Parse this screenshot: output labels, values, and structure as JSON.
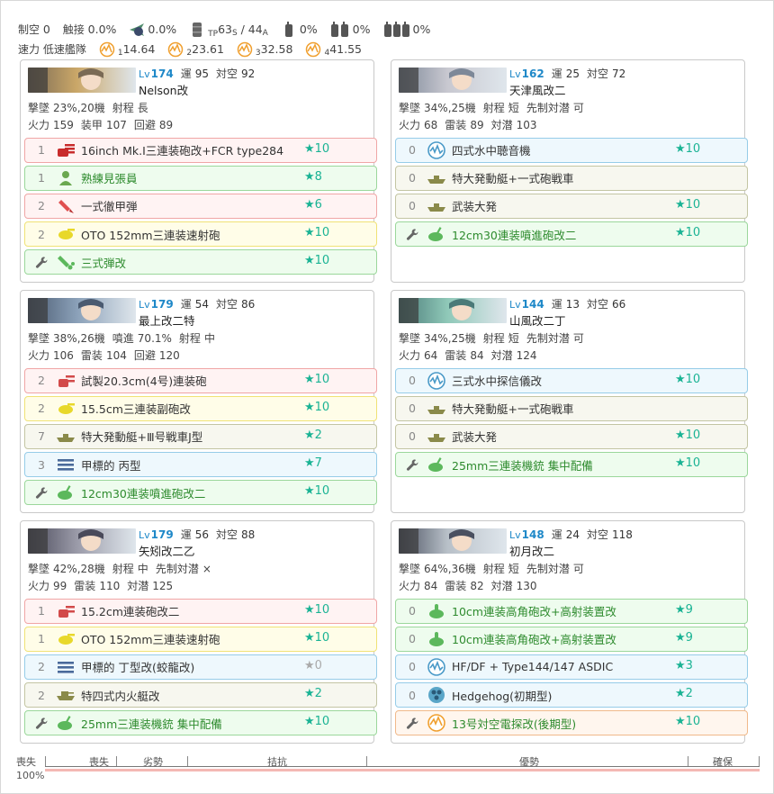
{
  "summary": {
    "air_control_label": "制空",
    "air_control_value": "0",
    "contact_label": "触接",
    "contact_value": "0.0%",
    "contact_plane_value": "0.0%",
    "tp_value": "63",
    "tp_sub": "S",
    "tp_slash": "/ 44",
    "tp_sub2": "A",
    "drum1_value": "0%",
    "drum2_value": "0%",
    "drum3_value": "0%",
    "speed_label": "速力",
    "speed_value": "低速艦隊",
    "los": [
      {
        "sub": "1",
        "value": "14.64"
      },
      {
        "sub": "2",
        "value": "23.61"
      },
      {
        "sub": "3",
        "value": "32.58"
      },
      {
        "sub": "4",
        "value": "41.55"
      }
    ]
  },
  "labels": {
    "lv": "Lv",
    "luck": "運",
    "aa": "対空",
    "shootdown": "撃墜",
    "range": "射程",
    "oasw": "先制対潜",
    "fp": "火力",
    "armor": "装甲",
    "evasion": "回避",
    "torpedo": "雷装",
    "asw": "対潜",
    "spread": "噴進"
  },
  "ships": [
    {
      "level": "174",
      "luck": "95",
      "aa": "92",
      "name": "Nelson改",
      "shootdown": "23%,20機",
      "range": "長",
      "stats": [
        {
          "l": "火力",
          "v": "159"
        },
        {
          "l": "装甲",
          "v": "107"
        },
        {
          "l": "回避",
          "v": "89"
        }
      ],
      "equip": [
        {
          "slot": "1",
          "name": "16inch Mk.I三連装砲改+FCR type284",
          "star": "★10",
          "color": "red",
          "icon": "heavy-gun-icon"
        },
        {
          "slot": "1",
          "name": "熟練見張員",
          "star": "★8",
          "color": "green",
          "icon": "lookout-icon"
        },
        {
          "slot": "2",
          "name": "一式徹甲弾",
          "star": "★6",
          "color": "red",
          "icon": "ap-shell-icon"
        },
        {
          "slot": "2",
          "name": "OTO 152mm三連装速射砲",
          "star": "★10",
          "color": "yellow",
          "icon": "secondary-gun-icon"
        },
        {
          "slot": "",
          "name": "三式弾改",
          "star": "★10",
          "color": "green",
          "icon": "type3-shell-icon",
          "fit": true
        }
      ]
    },
    {
      "level": "162",
      "luck": "25",
      "aa": "72",
      "name": "天津風改二",
      "shootdown": "34%,25機",
      "range": "短",
      "oasw": "可",
      "stats": [
        {
          "l": "火力",
          "v": "68"
        },
        {
          "l": "雷装",
          "v": "89"
        },
        {
          "l": "対潜",
          "v": "103"
        }
      ],
      "equip": [
        {
          "slot": "0",
          "name": "四式水中聴音機",
          "star": "★10",
          "color": "blue",
          "icon": "sonar-icon"
        },
        {
          "slot": "0",
          "name": "特大発動艇+一式砲戦車",
          "star": "",
          "color": "olive",
          "icon": "landing-craft-icon"
        },
        {
          "slot": "0",
          "name": "武装大発",
          "star": "★10",
          "color": "olive",
          "icon": "landing-craft-icon"
        },
        {
          "slot": "",
          "name": "12cm30連装噴進砲改二",
          "star": "★10",
          "color": "green",
          "icon": "aa-gun-icon",
          "fit": true
        }
      ]
    },
    {
      "level": "179",
      "luck": "54",
      "aa": "86",
      "name": "最上改二特",
      "shootdown": "38%,26機",
      "spread": "70.1%",
      "range": "中",
      "stats": [
        {
          "l": "火力",
          "v": "106"
        },
        {
          "l": "雷装",
          "v": "104"
        },
        {
          "l": "回避",
          "v": "120"
        }
      ],
      "equip": [
        {
          "slot": "2",
          "name": "試製20.3cm(4号)連装砲",
          "star": "★10",
          "color": "red",
          "icon": "medium-gun-icon"
        },
        {
          "slot": "2",
          "name": "15.5cm三連装副砲改",
          "star": "★10",
          "color": "yellow",
          "icon": "secondary-gun-icon"
        },
        {
          "slot": "7",
          "name": "特大発動艇+Ⅲ号戦車J型",
          "star": "★2",
          "color": "olive",
          "icon": "landing-craft-icon"
        },
        {
          "slot": "3",
          "name": "甲標的 丙型",
          "star": "★7",
          "color": "blue",
          "icon": "midget-sub-icon"
        },
        {
          "slot": "",
          "name": "12cm30連装噴進砲改二",
          "star": "★10",
          "color": "green",
          "icon": "aa-gun-icon",
          "fit": true
        }
      ]
    },
    {
      "level": "144",
      "luck": "13",
      "aa": "66",
      "name": "山風改二丁",
      "shootdown": "34%,25機",
      "range": "短",
      "oasw": "可",
      "stats": [
        {
          "l": "火力",
          "v": "64"
        },
        {
          "l": "雷装",
          "v": "84"
        },
        {
          "l": "対潜",
          "v": "124"
        }
      ],
      "equip": [
        {
          "slot": "0",
          "name": "三式水中探信儀改",
          "star": "★10",
          "color": "blue",
          "icon": "sonar-icon"
        },
        {
          "slot": "0",
          "name": "特大発動艇+一式砲戦車",
          "star": "",
          "color": "olive",
          "icon": "landing-craft-icon"
        },
        {
          "slot": "0",
          "name": "武装大発",
          "star": "★10",
          "color": "olive",
          "icon": "landing-craft-icon"
        },
        {
          "slot": "",
          "name": "25mm三連装機銃 集中配備",
          "star": "★10",
          "color": "green",
          "icon": "aa-gun-icon",
          "fit": true
        }
      ]
    },
    {
      "level": "179",
      "luck": "56",
      "aa": "88",
      "name": "矢矧改二乙",
      "shootdown": "42%,28機",
      "range": "中",
      "oasw": "×",
      "stats": [
        {
          "l": "火力",
          "v": "99"
        },
        {
          "l": "雷装",
          "v": "110"
        },
        {
          "l": "対潜",
          "v": "125"
        }
      ],
      "equip": [
        {
          "slot": "1",
          "name": "15.2cm連装砲改二",
          "star": "★10",
          "color": "red",
          "icon": "medium-gun-icon"
        },
        {
          "slot": "1",
          "name": "OTO 152mm三連装速射砲",
          "star": "★10",
          "color": "yellow",
          "icon": "secondary-gun-icon"
        },
        {
          "slot": "2",
          "name": "甲標的 丁型改(蛟龍改)",
          "star": "★0",
          "color": "blue",
          "icon": "midget-sub-icon",
          "grey": true
        },
        {
          "slot": "2",
          "name": "特四式内火艇改",
          "star": "★2",
          "color": "olive",
          "icon": "amphibious-tank-icon"
        },
        {
          "slot": "",
          "name": "25mm三連装機銃 集中配備",
          "star": "★10",
          "color": "green",
          "icon": "aa-gun-icon",
          "fit": true
        }
      ]
    },
    {
      "level": "148",
      "luck": "24",
      "aa": "118",
      "name": "初月改二",
      "shootdown": "64%,36機",
      "range": "短",
      "oasw": "可",
      "stats": [
        {
          "l": "火力",
          "v": "84"
        },
        {
          "l": "雷装",
          "v": "82"
        },
        {
          "l": "対潜",
          "v": "130"
        }
      ],
      "equip": [
        {
          "slot": "0",
          "name": "10cm連装高角砲改+高射装置改",
          "star": "★9",
          "color": "green",
          "icon": "ha-gun-icon"
        },
        {
          "slot": "0",
          "name": "10cm連装高角砲改+高射装置改",
          "star": "★9",
          "color": "green",
          "icon": "ha-gun-icon"
        },
        {
          "slot": "0",
          "name": "HF/DF + Type144/147 ASDIC",
          "star": "★3",
          "color": "blue",
          "icon": "sonar-icon"
        },
        {
          "slot": "0",
          "name": "Hedgehog(初期型)",
          "star": "★2",
          "color": "blue",
          "icon": "depth-charge-icon"
        },
        {
          "slot": "",
          "name": "13号対空電探改(後期型)",
          "star": "★10",
          "color": "orange",
          "icon": "radar-icon",
          "fit": true
        }
      ]
    }
  ],
  "gauge": {
    "left_label": "喪失",
    "percent": "100%",
    "segments": [
      "喪失",
      "劣勢",
      "拮抗",
      "優勢",
      "確保"
    ]
  }
}
